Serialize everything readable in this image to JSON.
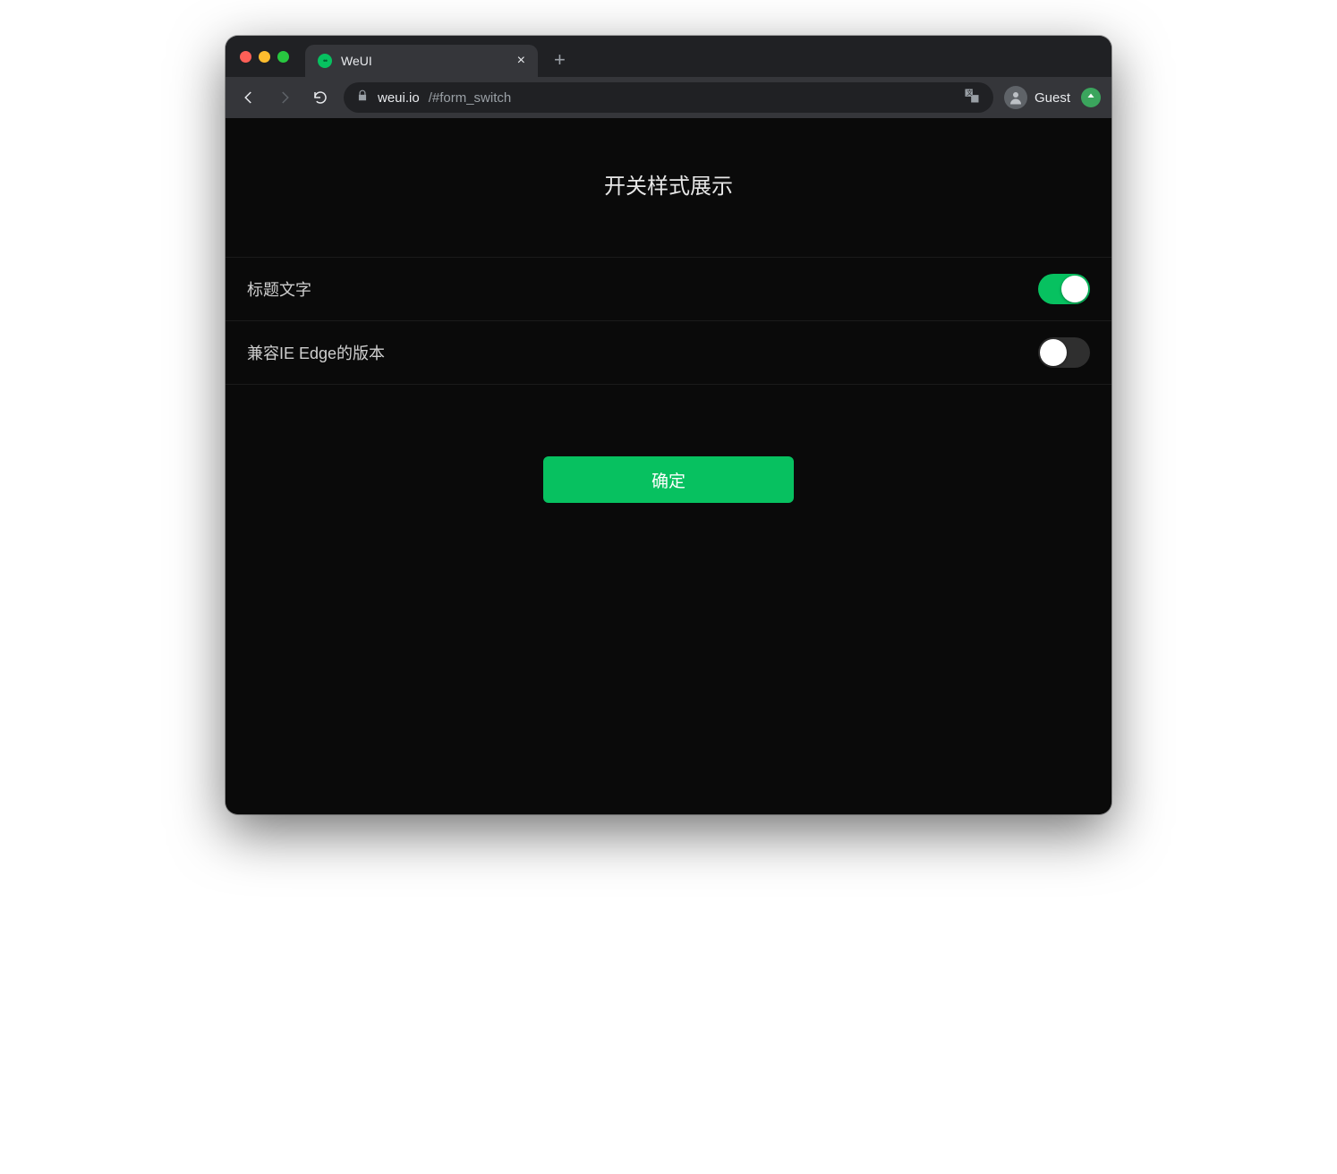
{
  "browser": {
    "tab_title": "WeUI",
    "url_host": "weui.io",
    "url_path": "/#form_switch",
    "guest_label": "Guest"
  },
  "page": {
    "title": "开关样式展示",
    "rows": [
      {
        "label": "标题文字",
        "checked": true
      },
      {
        "label": "兼容IE Edge的版本",
        "checked": false
      }
    ],
    "confirm_label": "确定"
  },
  "colors": {
    "accent": "#07c160",
    "page_bg": "#0a0a0a"
  }
}
